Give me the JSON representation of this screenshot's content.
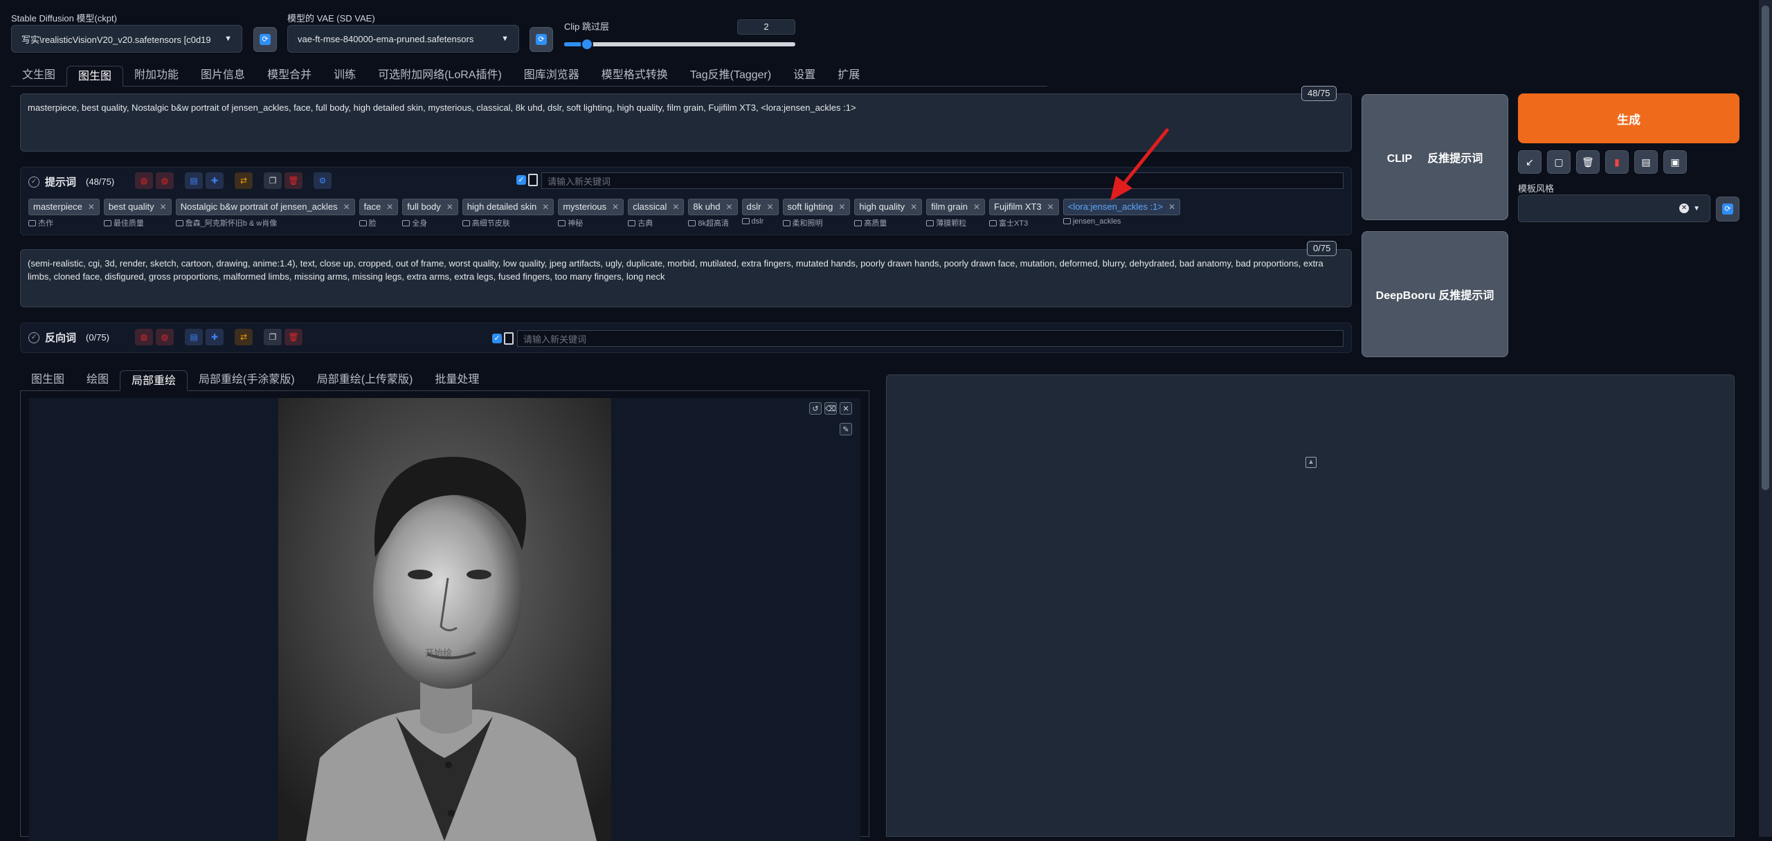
{
  "top": {
    "ckpt_label": "Stable Diffusion 模型(ckpt)",
    "ckpt_value": "写实\\realisticVisionV20_v20.safetensors [c0d19",
    "vae_label": "模型的 VAE (SD VAE)",
    "vae_value": "vae-ft-mse-840000-ema-pruned.safetensors",
    "clip_label": "Clip 跳过层",
    "clip_value": "2",
    "clip_slider_fraction": 0.1,
    "refresh_icon": "refresh-icon"
  },
  "main_tabs": [
    "文生图",
    "图生图",
    "附加功能",
    "图片信息",
    "模型合并",
    "训练",
    "可选附加网络(LoRA插件)",
    "图库浏览器",
    "模型格式转换",
    "Tag反推(Tagger)",
    "设置",
    "扩展"
  ],
  "prompt": {
    "text": "masterpiece, best quality, Nostalgic b&w portrait of jensen_ackles, face, full body, high detailed skin, mysterious, classical, 8k uhd, dslr, soft lighting, high quality, film grain, Fujifilm XT3, <lora:jensen_ackles :1>",
    "counter": "48/75",
    "label": "提示词",
    "count": "(48/75)",
    "keyword_placeholder": "请输入新关键词"
  },
  "prompt_tags": [
    {
      "tag": "masterpiece",
      "trans": "杰作"
    },
    {
      "tag": "best quality",
      "trans": "最佳质量"
    },
    {
      "tag": "Nostalgic b&w portrait of jensen_ackles",
      "trans": "詹森_阿克斯怀旧b & w肖像"
    },
    {
      "tag": "face",
      "trans": "脸"
    },
    {
      "tag": "full body",
      "trans": "全身"
    },
    {
      "tag": "high detailed skin",
      "trans": "高细节皮肤"
    },
    {
      "tag": "mysterious",
      "trans": "神秘"
    },
    {
      "tag": "classical",
      "trans": "古典"
    },
    {
      "tag": "8k uhd",
      "trans": "8k超高清"
    },
    {
      "tag": "dslr",
      "trans": "dslr"
    },
    {
      "tag": "soft lighting",
      "trans": "柔和照明"
    },
    {
      "tag": "high quality",
      "trans": "高质量"
    },
    {
      "tag": "film grain",
      "trans": "薄膜颗粒"
    },
    {
      "tag": "Fujifilm XT3",
      "trans": "富士XT3"
    },
    {
      "tag": "<lora:jensen_ackles :1>",
      "trans": "jensen_ackles",
      "lora": true
    }
  ],
  "negative": {
    "text": "(semi-realistic, cgi, 3d, render, sketch, cartoon, drawing, anime:1.4), text, close up, cropped, out of frame, worst quality, low quality, jpeg artifacts, ugly, duplicate, morbid, mutilated, extra fingers, mutated hands, poorly drawn hands, poorly drawn face, mutation, deformed, blurry, dehydrated, bad anatomy, bad proportions, extra limbs, cloned face, disfigured, gross proportions, malformed limbs, missing arms, missing legs, extra arms, extra legs, fused fingers, too many fingers, long neck",
    "counter": "0/75",
    "label": "反向词",
    "count": "(0/75)",
    "keyword_placeholder": "请输入新关键词"
  },
  "right": {
    "clip_btn": "CLIP      反推提示词",
    "deepbooru_btn": "DeepBooru 反推提示词",
    "generate_btn": "生成",
    "style_label": "模板风格",
    "tool_icons": [
      "check-icon",
      "square-icon",
      "trash-icon",
      "bookmark-icon",
      "clipboard-icon",
      "save-icon"
    ]
  },
  "sub_tabs": [
    "图生图",
    "绘图",
    "局部重绘",
    "局部重绘(手涂蒙版)",
    "局部重绘(上传蒙版)",
    "批量处理"
  ],
  "canvas": {
    "overlay_text": "开始绘"
  },
  "colors": {
    "accent": "#f97316",
    "blue": "#2f8ef4",
    "bg": "#0b0f19",
    "arrow": "#e11d1d"
  }
}
